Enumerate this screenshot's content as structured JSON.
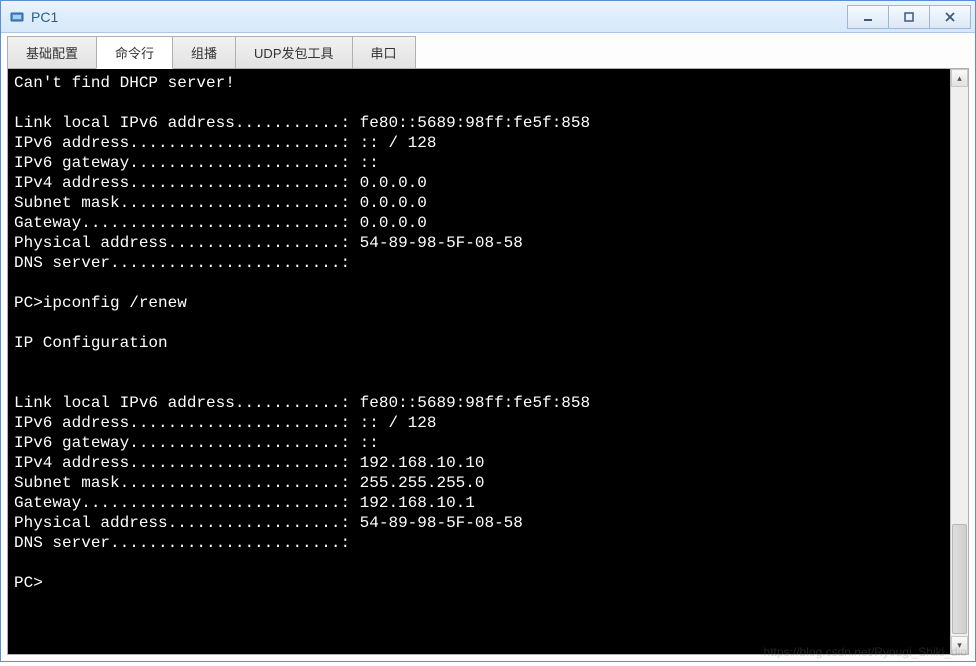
{
  "window": {
    "title": "PC1"
  },
  "tabs": {
    "t0": "基础配置",
    "t1": "命令行",
    "t2": "组播",
    "t3": "UDP发包工具",
    "t4": "串口"
  },
  "terminal": {
    "lines": {
      "l00": "Can't find DHCP server!",
      "l01": "",
      "l02": "Link local IPv6 address...........: fe80::5689:98ff:fe5f:858",
      "l03": "IPv6 address......................: :: / 128",
      "l04": "IPv6 gateway......................: ::",
      "l05": "IPv4 address......................: 0.0.0.0",
      "l06": "Subnet mask.......................: 0.0.0.0",
      "l07": "Gateway...........................: 0.0.0.0",
      "l08": "Physical address..................: 54-89-98-5F-08-58",
      "l09": "DNS server........................:",
      "l10": "",
      "l11": "PC>ipconfig /renew",
      "l12": "",
      "l13": "IP Configuration",
      "l14": "",
      "l15": "",
      "l16": "Link local IPv6 address...........: fe80::5689:98ff:fe5f:858",
      "l17": "IPv6 address......................: :: / 128",
      "l18": "IPv6 gateway......................: ::",
      "l19": "IPv4 address......................: 192.168.10.10",
      "l20": "Subnet mask.......................: 255.255.255.0",
      "l21": "Gateway...........................: 192.168.10.1",
      "l22": "Physical address..................: 54-89-98-5F-08-58",
      "l23": "DNS server........................:",
      "l24": "",
      "l25": "PC>"
    }
  },
  "watermark": "https://blog.csdn.net/Ryougi_Shiki_dio"
}
